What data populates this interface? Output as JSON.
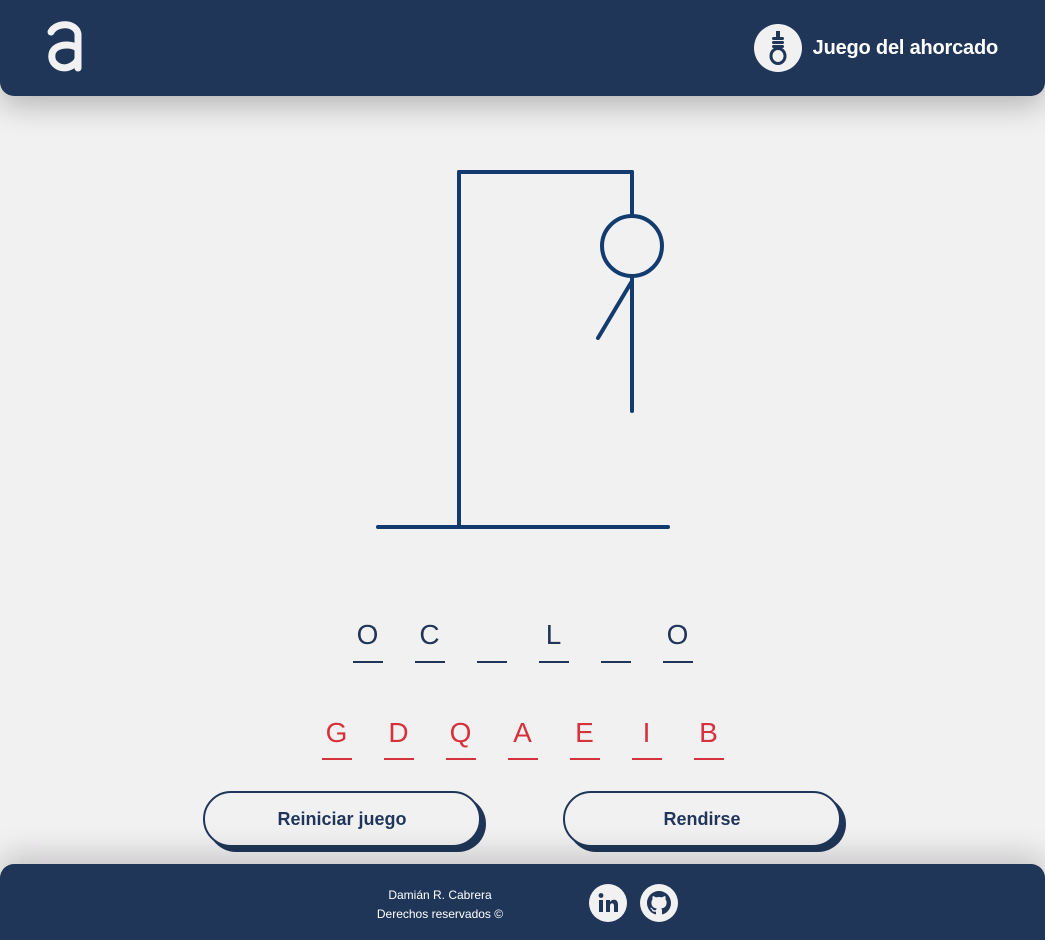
{
  "header": {
    "logo_icon": "a-logo-icon",
    "brand_icon": "noose-icon",
    "title": "Juego del ahorcado"
  },
  "game": {
    "word_slots": [
      "O",
      "C",
      "",
      "L",
      "",
      "O"
    ],
    "wrong_letters": [
      "G",
      "D",
      "Q",
      "A",
      "E",
      "I",
      "B"
    ],
    "errors_shown": 3
  },
  "buttons": {
    "restart": "Reiniciar juego",
    "surrender": "Rendirse"
  },
  "footer": {
    "author": "Damián R. Cabrera",
    "rights": "Derechos reservados ©",
    "social": [
      "linkedin-icon",
      "github-icon"
    ]
  },
  "colors": {
    "primary": "#1f3659",
    "background": "#f2f1f2",
    "error": "#d6323c",
    "drawing": "#123b70"
  }
}
